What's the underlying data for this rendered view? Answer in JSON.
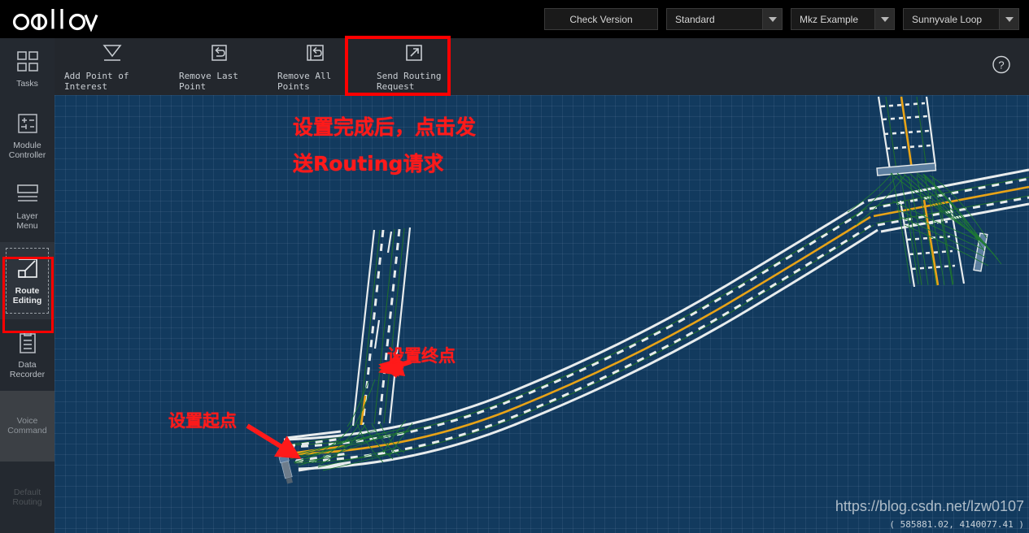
{
  "app": {
    "name": "apollo",
    "logo_text": "apollo"
  },
  "header": {
    "check_version_label": "Check Version",
    "mode_select": {
      "value": "Standard",
      "icon": "chevron-down-icon"
    },
    "vehicle_select": {
      "value": "Mkz Example",
      "icon": "chevron-down-icon"
    },
    "map_select": {
      "value": "Sunnyvale Loop",
      "icon": "chevron-down-icon"
    }
  },
  "sidebar": {
    "items": [
      {
        "label": "Tasks",
        "icon": "grid-four-squares-icon",
        "state": "normal"
      },
      {
        "label": "Module\nController",
        "icon": "module-controller-icon",
        "state": "normal"
      },
      {
        "label": "Layer\nMenu",
        "icon": "layer-menu-icon",
        "state": "normal"
      },
      {
        "label": "Route\nEditing",
        "icon": "route-editing-icon",
        "state": "selected"
      },
      {
        "label": "Data\nRecorder",
        "icon": "clipboard-icon",
        "state": "normal"
      },
      {
        "label": "Voice\nCommand",
        "icon": "none",
        "state": "hover"
      },
      {
        "label": "Default\nRouting",
        "icon": "none",
        "state": "disabled"
      }
    ]
  },
  "toolbar": {
    "buttons": [
      {
        "label": "Add Point of Interest",
        "icon": "triangle-down-line-icon"
      },
      {
        "label": "Remove Last Point",
        "icon": "undo-box-icon"
      },
      {
        "label": "Remove All Points",
        "icon": "undo-double-box-icon"
      },
      {
        "label": "Send Routing Request",
        "icon": "external-link-arrow-icon"
      }
    ],
    "help_icon": "question-circle-icon"
  },
  "map": {
    "annotations": [
      {
        "id": "top",
        "lines": [
          "设置完成后，点击发",
          "送Routing请求"
        ]
      },
      {
        "id": "end",
        "text": "设置终点"
      },
      {
        "id": "start",
        "text": "设置起点"
      }
    ],
    "watermark": "https://blog.csdn.net/lzw0107",
    "coordinates": "( 585881.02, 4140077.41 )"
  },
  "colors": {
    "accent_red": "#ff0000",
    "map_background": "#123a5e",
    "lane_line_white": "#e8eced",
    "center_line_yellow": "#e8a317",
    "lane_path_green": "#1e6b2e",
    "header_black": "#000000",
    "sidebar_gray": "#242930",
    "toolbar_gray": "#23272d"
  }
}
